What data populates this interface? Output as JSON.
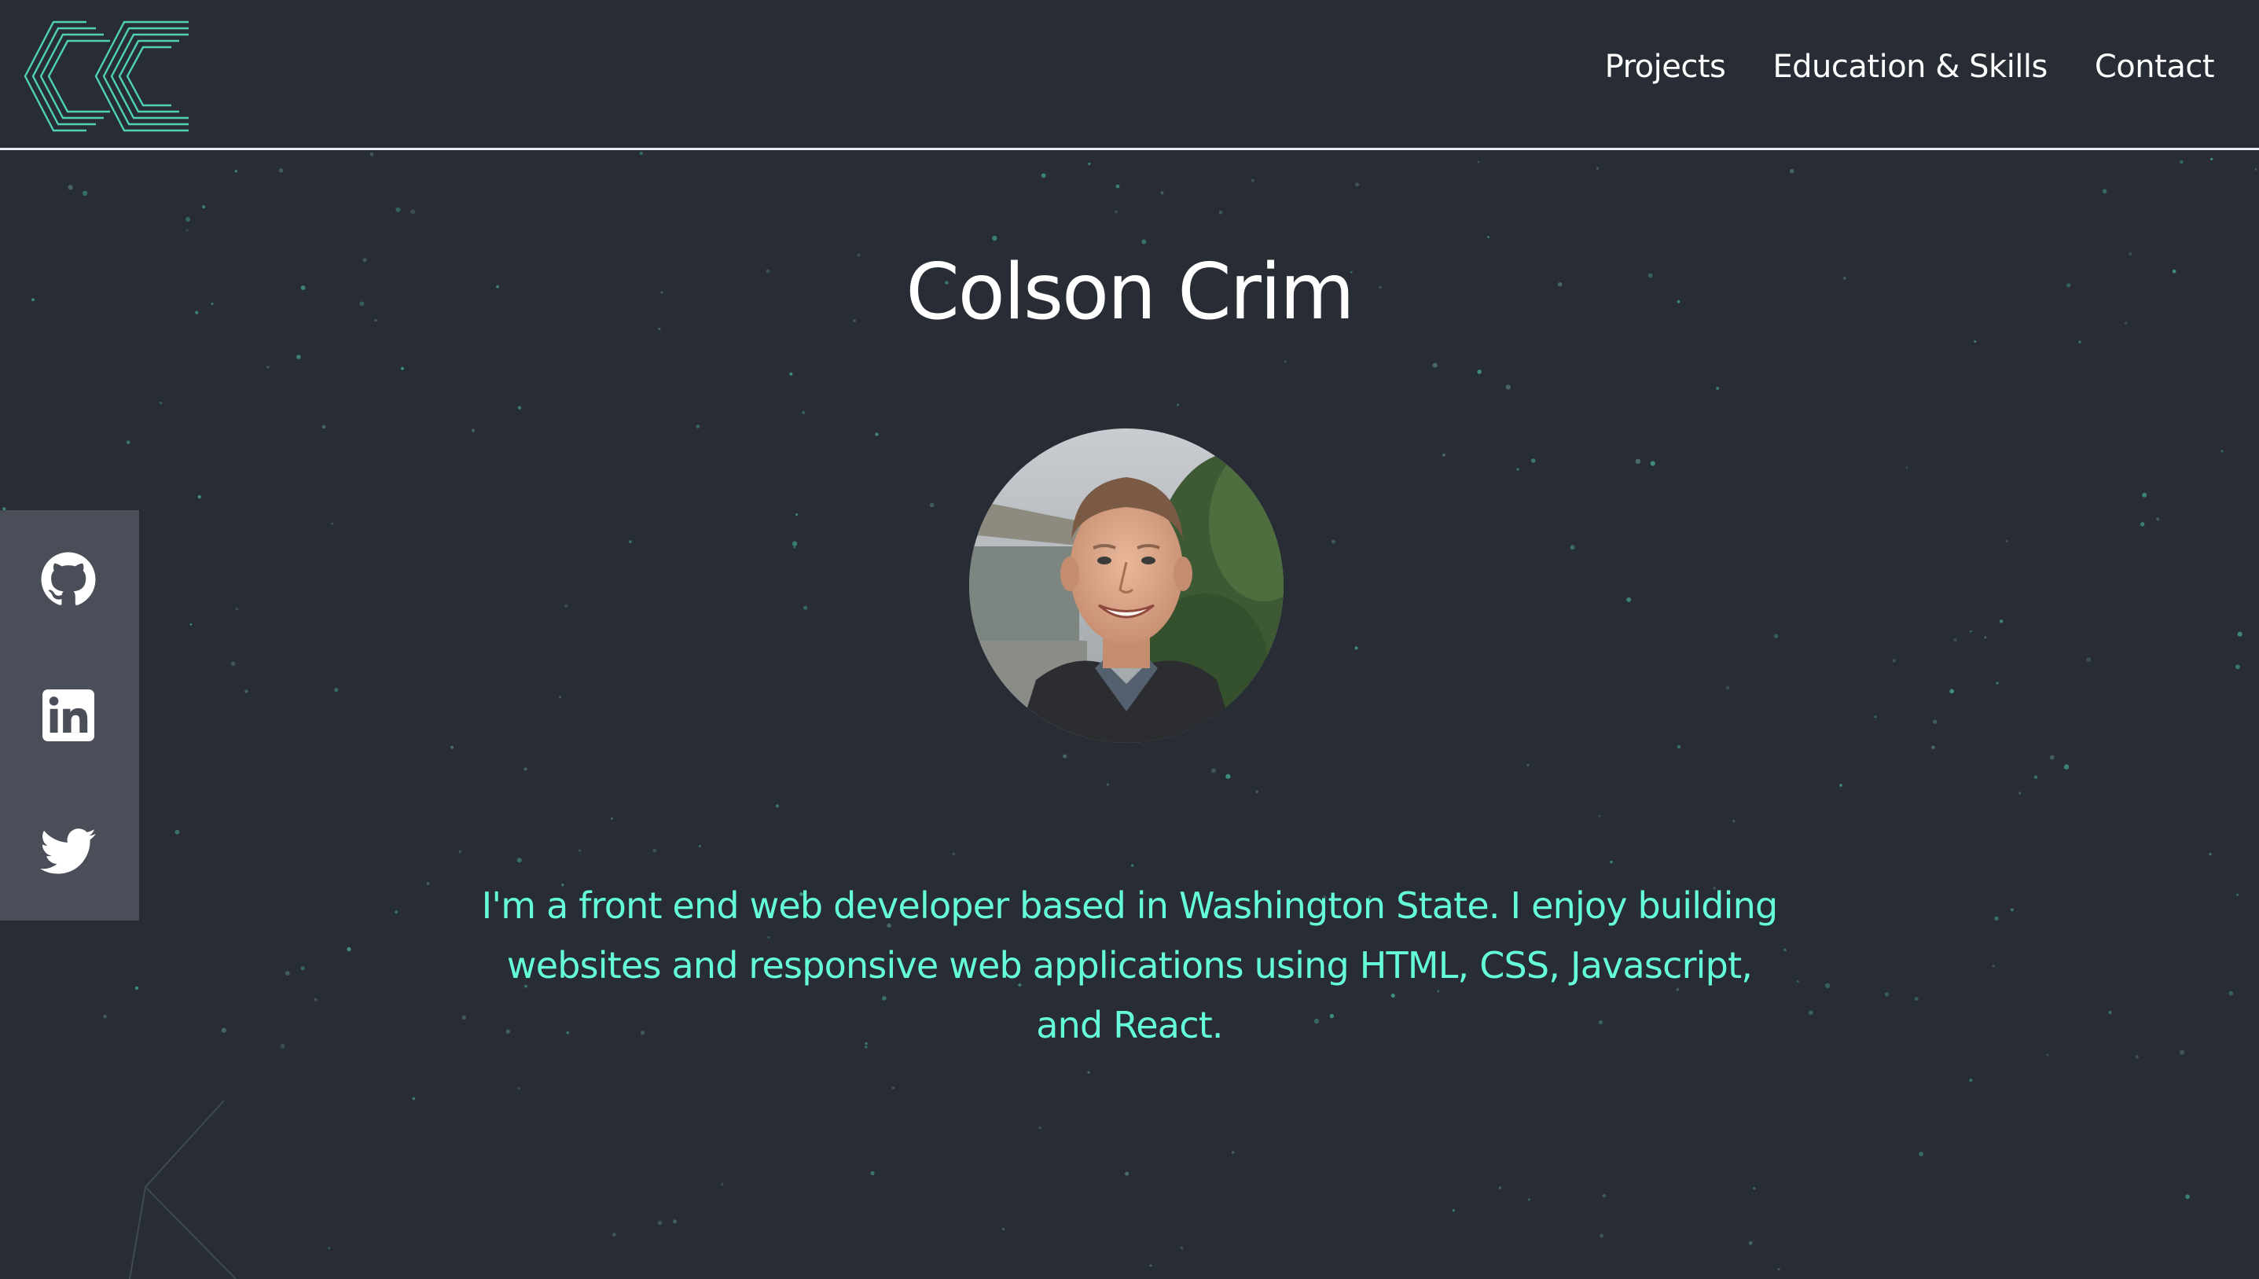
{
  "header": {
    "logo_alt": "CC",
    "nav": [
      {
        "label": "Projects"
      },
      {
        "label": "Education & Skills"
      },
      {
        "label": "Contact"
      }
    ]
  },
  "hero": {
    "name": "Colson Crim",
    "bio": "I'm a front end web developer based in Washington State. I enjoy building websites and responsive web applications using HTML, CSS, Javascript, and React."
  },
  "social": {
    "items": [
      {
        "icon": "github-icon"
      },
      {
        "icon": "linkedin-icon"
      },
      {
        "icon": "twitter-icon"
      }
    ]
  },
  "colors": {
    "background": "#282c34",
    "accent": "#64ffda",
    "text": "#ffffff",
    "social_bar": "#4a4e58"
  }
}
